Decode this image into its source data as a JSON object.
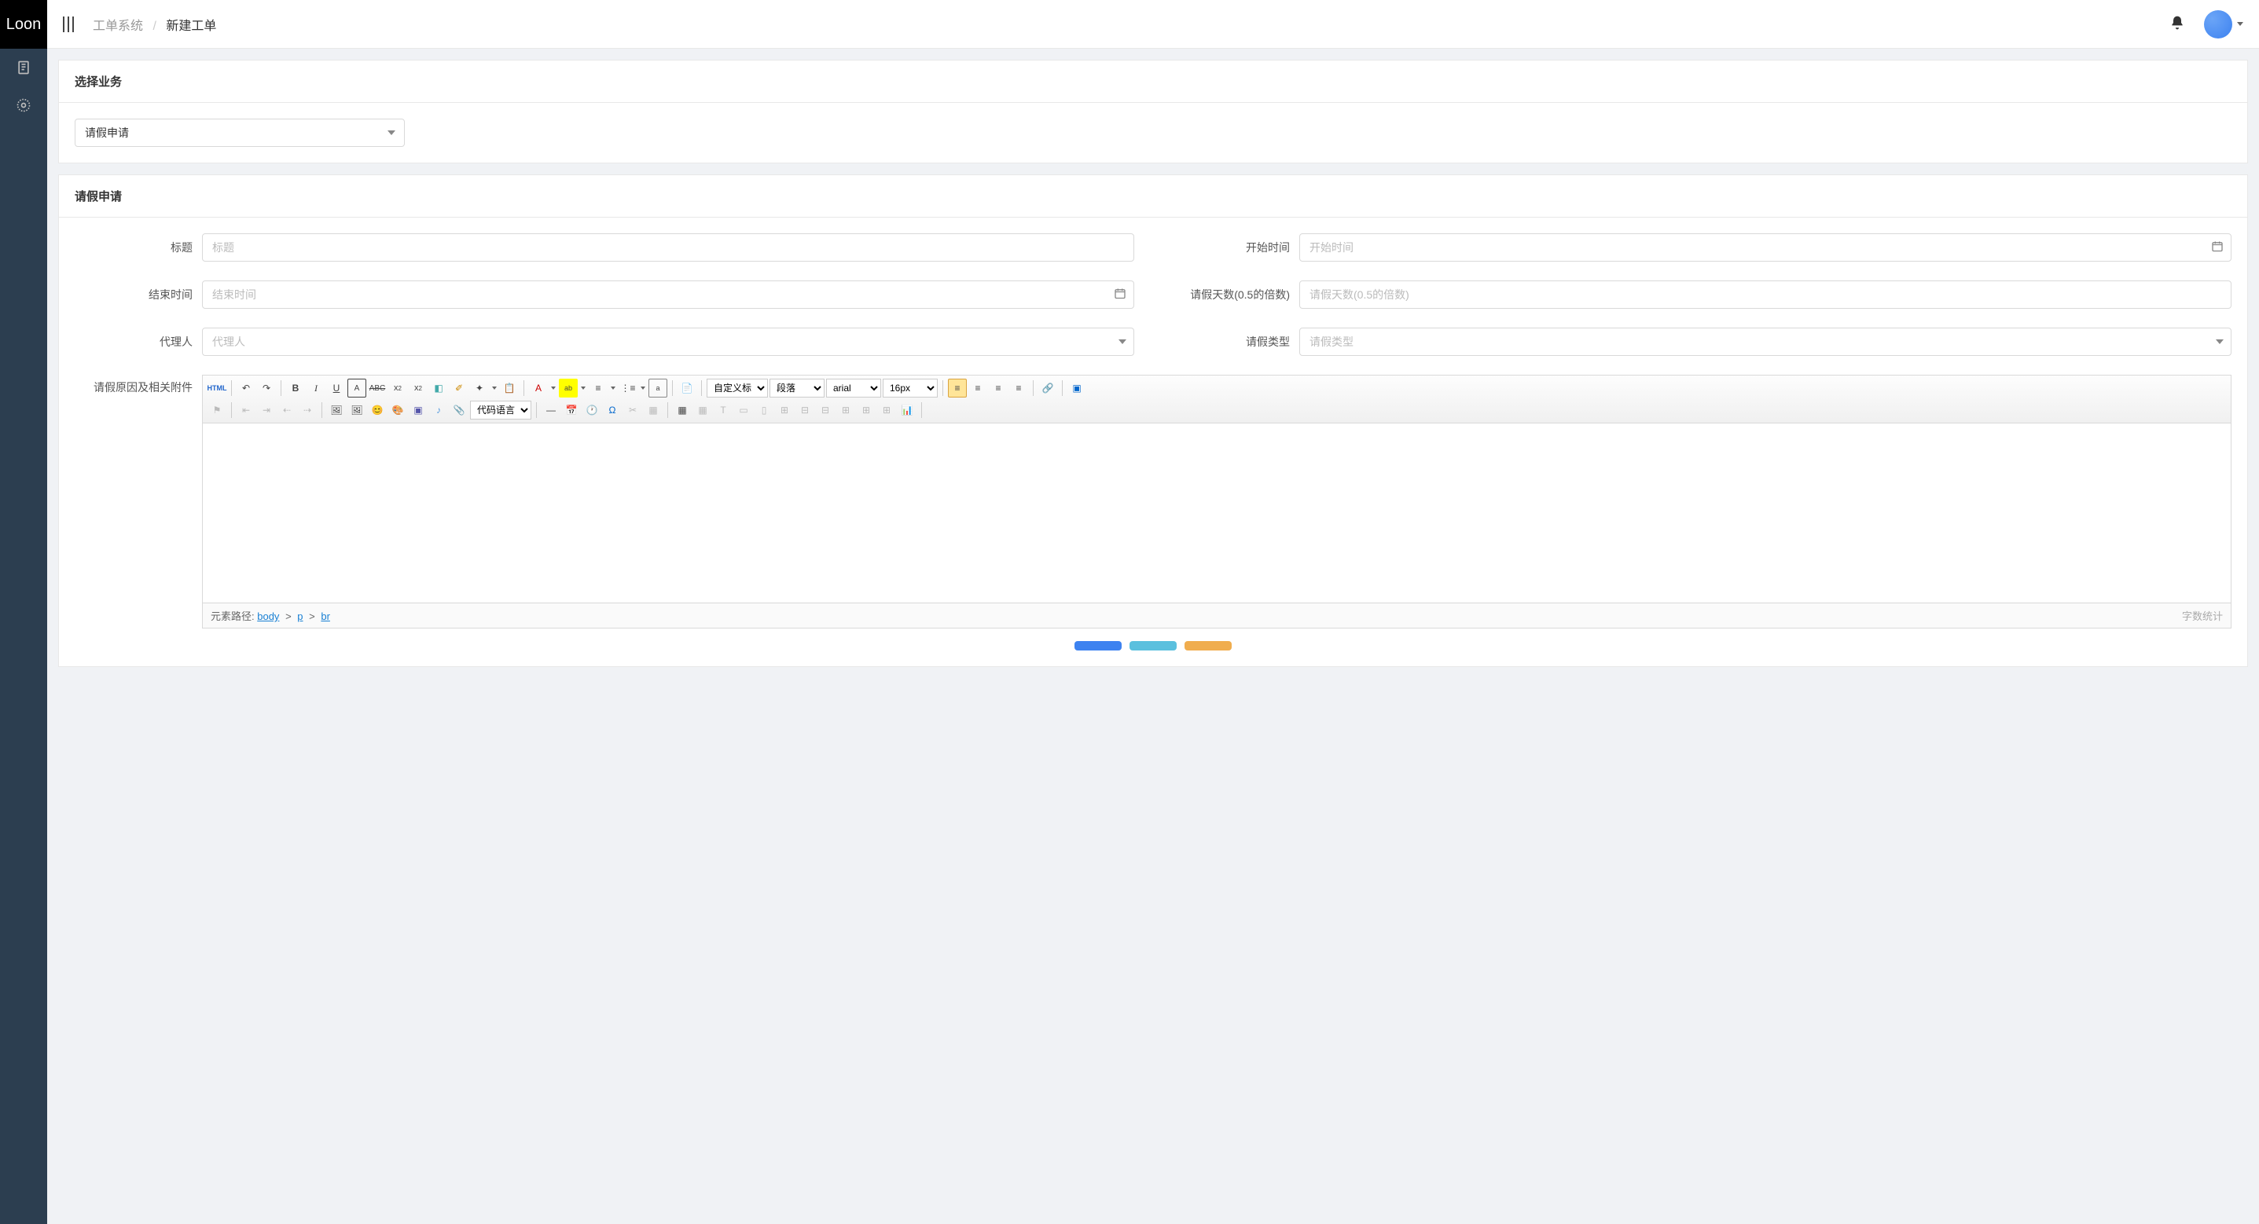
{
  "brand": "Loon",
  "breadcrumb": {
    "parent": "工单系统",
    "current": "新建工单"
  },
  "sections": {
    "select_business": {
      "title": "选择业务",
      "selected": "请假申请"
    },
    "leave_form": {
      "title": "请假申请"
    }
  },
  "fields": {
    "title": {
      "label": "标题",
      "placeholder": "标题"
    },
    "start_time": {
      "label": "开始时间",
      "placeholder": "开始时间"
    },
    "end_time": {
      "label": "结束时间",
      "placeholder": "结束时间"
    },
    "days": {
      "label": "请假天数(0.5的倍数)",
      "placeholder": "请假天数(0.5的倍数)"
    },
    "proxy": {
      "label": "代理人",
      "placeholder": "代理人"
    },
    "leave_type": {
      "label": "请假类型",
      "placeholder": "请假类型"
    },
    "reason": {
      "label": "请假原因及相关附件"
    }
  },
  "editor": {
    "custom_title": "自定义标题",
    "paragraph": "段落",
    "font": "arial",
    "font_size": "16px",
    "code_lang": "代码语言",
    "path_label": "元素路径: ",
    "path_parts": {
      "body": "body",
      "p": "p",
      "br": "br"
    },
    "word_count": "字数统计"
  },
  "icons": {
    "html": "HTML",
    "bold": "B",
    "italic": "I",
    "underline": "U"
  }
}
